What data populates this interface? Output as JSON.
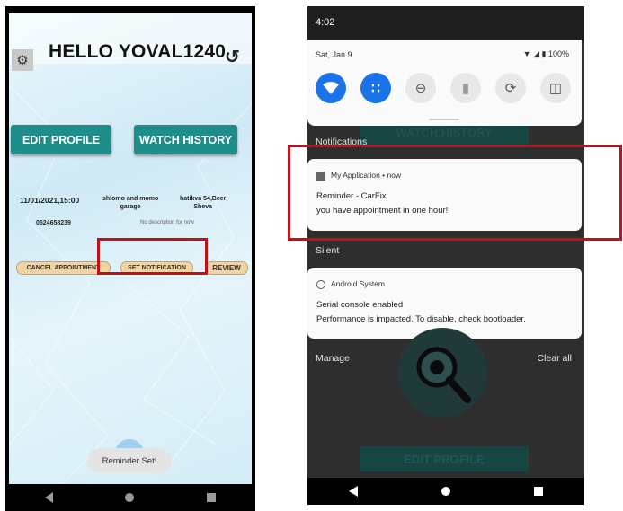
{
  "left_phone": {
    "title": "HELLO YOVAL1240",
    "settings_icon": "gear-icon",
    "back_icon": "undo-arrow-icon",
    "edit_profile_label": "EDIT PROFILE",
    "watch_history_label": "WATCH HISTORY",
    "appointment": {
      "datetime": "11/01/2021,15:00",
      "garage_line1": "shlomo and momo",
      "garage_line2": "garage",
      "address_line1": "hatikva 54,Beer",
      "address_line2": "Sheva",
      "phone": "0524658239",
      "description": "No description for now"
    },
    "cancel_label": "CANCEL APPOINTMENT",
    "set_notification_label": "SET NOTIFICATION",
    "review_label": "REVIEW",
    "toast": "Reminder Set!",
    "nav_icons": [
      "back-triangle-icon",
      "home-circle-icon",
      "recents-square-icon"
    ]
  },
  "right_phone": {
    "time": "4:02",
    "date": "Sat, Jan 9",
    "battery": "100%",
    "quick_tiles": [
      "wifi-icon",
      "bluetooth-icon",
      "do-not-disturb-icon",
      "flashlight-icon",
      "auto-rotate-icon",
      "battery-saver-icon"
    ],
    "background_watch_history": "WATCH HISTORY",
    "notifications_header": "Notifications",
    "app_notification": {
      "app": "My Application",
      "time": "now",
      "title": "Reminder - CarFix",
      "body": "you have appointment in one hour!"
    },
    "silent_header": "Silent",
    "system_notification": {
      "app": "Android System",
      "title": "Serial console enabled",
      "body": "Performance is impacted. To disable, check bootloader."
    },
    "manage_label": "Manage",
    "clear_all_label": "Clear all",
    "background_edit_profile": "EDIT PROFILE"
  },
  "colors": {
    "teal_button": "#1f8e8a",
    "highlight_red": "#c30f16",
    "qs_active_blue": "#1a73e8"
  }
}
